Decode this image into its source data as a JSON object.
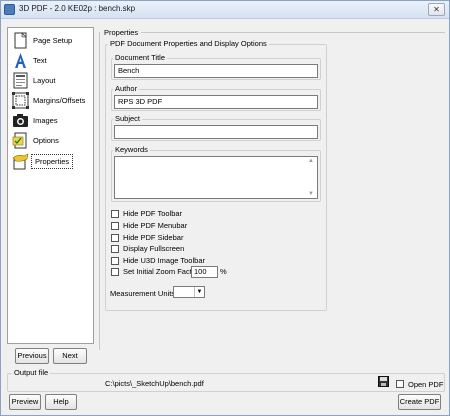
{
  "window": {
    "title": "3D PDF - 2.0 KE02p : bench.skp",
    "close_glyph": "✕"
  },
  "nav": {
    "items": [
      {
        "label": "Page Setup",
        "icon": "page-setup-icon"
      },
      {
        "label": "Text",
        "icon": "text-icon"
      },
      {
        "label": "Layout",
        "icon": "layout-icon"
      },
      {
        "label": "Margins/Offsets",
        "icon": "margins-icon"
      },
      {
        "label": "Images",
        "icon": "camera-icon"
      },
      {
        "label": "Options",
        "icon": "options-icon"
      },
      {
        "label": "Properties",
        "icon": "properties-icon",
        "selected": true
      }
    ],
    "previous_label": "Previous",
    "next_label": "Next"
  },
  "properties": {
    "section_label": "Properties",
    "group_label": "PDF Document Properties and Display Options",
    "document_title": {
      "label": "Document Title",
      "value": "Bench"
    },
    "author": {
      "label": "Author",
      "value": "RPS 3D PDF"
    },
    "subject": {
      "label": "Subject",
      "value": ""
    },
    "keywords": {
      "label": "Keywords",
      "value": ""
    },
    "checkboxes": [
      {
        "label": "Hide PDF Toolbar",
        "checked": false
      },
      {
        "label": "Hide PDF Menubar",
        "checked": false
      },
      {
        "label": "Hide PDF Sidebar",
        "checked": false
      },
      {
        "label": "Display Fullscreen",
        "checked": false
      },
      {
        "label": "Hide U3D Image Toolbar",
        "checked": false
      },
      {
        "label": "Set Initial Zoom Factor",
        "checked": false
      }
    ],
    "zoom_value": "100",
    "zoom_unit": "%",
    "measurement_units_label": "Measurement Units",
    "measurement_units_value": ""
  },
  "output": {
    "label": "Output file",
    "path": "C:\\picts\\_SketchUp\\bench.pdf",
    "open_pdf_label": "Open PDF",
    "open_pdf_checked": false
  },
  "footer": {
    "preview_label": "Preview",
    "help_label": "Help",
    "create_label": "Create PDF"
  },
  "colors": {
    "title_bar": "#dbe6f4",
    "panel": "#f0f0f0"
  }
}
